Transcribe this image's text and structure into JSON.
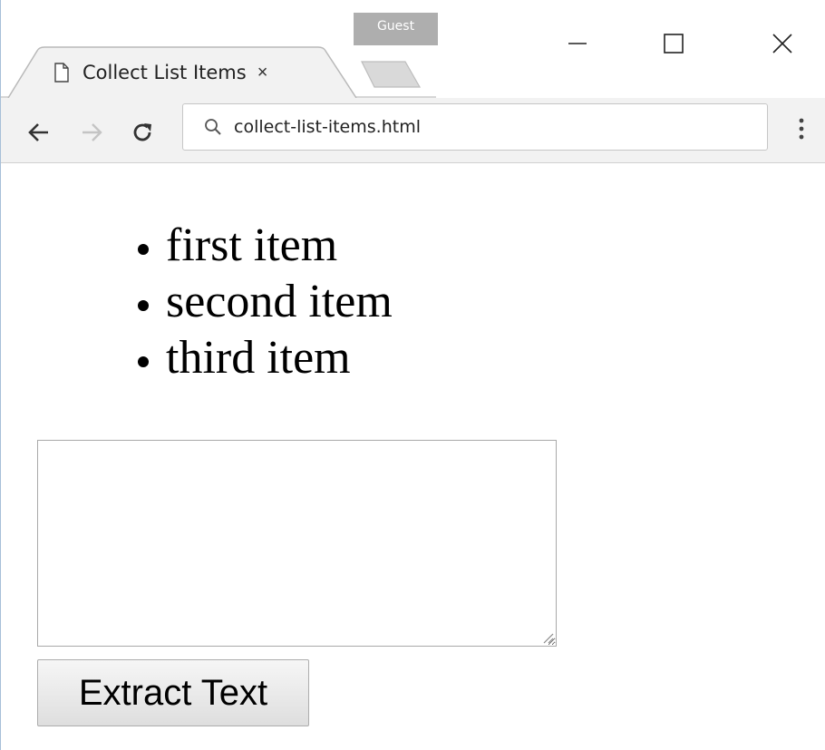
{
  "browser": {
    "profile_badge": "Guest",
    "tab": {
      "title": "Collect List Items",
      "close_glyph": "×"
    },
    "address_bar": {
      "url": "collect-list-items.html"
    },
    "icons": {
      "page": "page-icon",
      "back": "arrow-left-icon",
      "forward": "arrow-right-icon",
      "reload": "reload-icon",
      "search": "search-icon",
      "menu": "vertical-dots-icon",
      "minimize": "minimize-icon",
      "maximize": "maximize-icon",
      "close": "close-icon"
    }
  },
  "page": {
    "list_items": [
      "first item",
      "second item",
      "third item"
    ],
    "textarea": {
      "value": ""
    },
    "extract_button_label": "Extract Text"
  }
}
